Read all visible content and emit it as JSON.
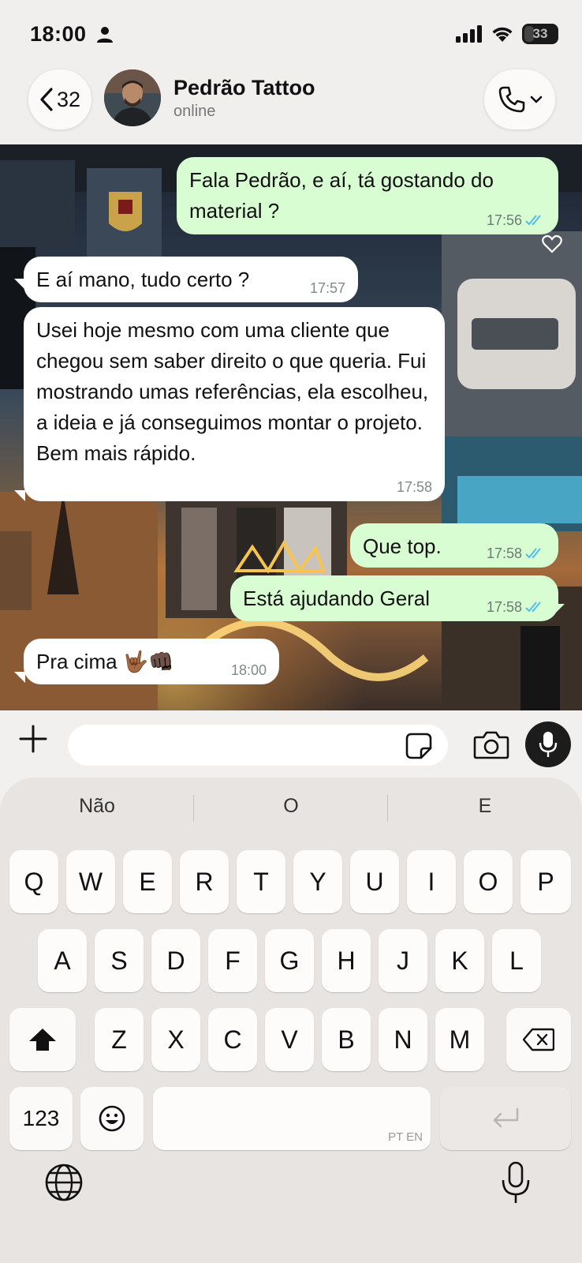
{
  "status_bar": {
    "time": "18:00",
    "battery": "33"
  },
  "header": {
    "back_count": "32",
    "contact_name": "Pedrão Tattoo",
    "contact_status": "online"
  },
  "messages": [
    {
      "direction": "out",
      "text": "Fala Pedrão, e aí, tá gostando do material ?",
      "time": "17:56",
      "read": true
    },
    {
      "direction": "in",
      "text": "E aí mano, tudo certo ?",
      "time": "17:57"
    },
    {
      "direction": "in",
      "text": "Usei hoje mesmo com uma cliente que chegou sem saber direito o que queria. Fui mostrando umas referências, ela escolheu, a ideia e já conseguimos montar o projeto. Bem mais rápido.",
      "time": "17:58"
    },
    {
      "direction": "out",
      "text": "Que top.",
      "time": "17:58",
      "read": true
    },
    {
      "direction": "out",
      "text": "Está ajudando Geral",
      "time": "17:58",
      "read": true
    },
    {
      "direction": "in",
      "text": "Pra cima 🤟🏾👊🏿",
      "time": "18:00"
    }
  ],
  "input": {
    "placeholder": ""
  },
  "keyboard": {
    "suggestions": [
      "Não",
      "O",
      "E"
    ],
    "row1": [
      "Q",
      "W",
      "E",
      "R",
      "T",
      "Y",
      "U",
      "I",
      "O",
      "P"
    ],
    "row2": [
      "A",
      "S",
      "D",
      "F",
      "G",
      "H",
      "J",
      "K",
      "L"
    ],
    "row3": [
      "Z",
      "X",
      "C",
      "V",
      "B",
      "N",
      "M"
    ],
    "numbers_key": "123",
    "space_lang": "PT EN"
  },
  "colors": {
    "incoming_bubble": "#ffffff",
    "outgoing_bubble": "#d9fdd3",
    "read_tick": "#53bdeb"
  }
}
